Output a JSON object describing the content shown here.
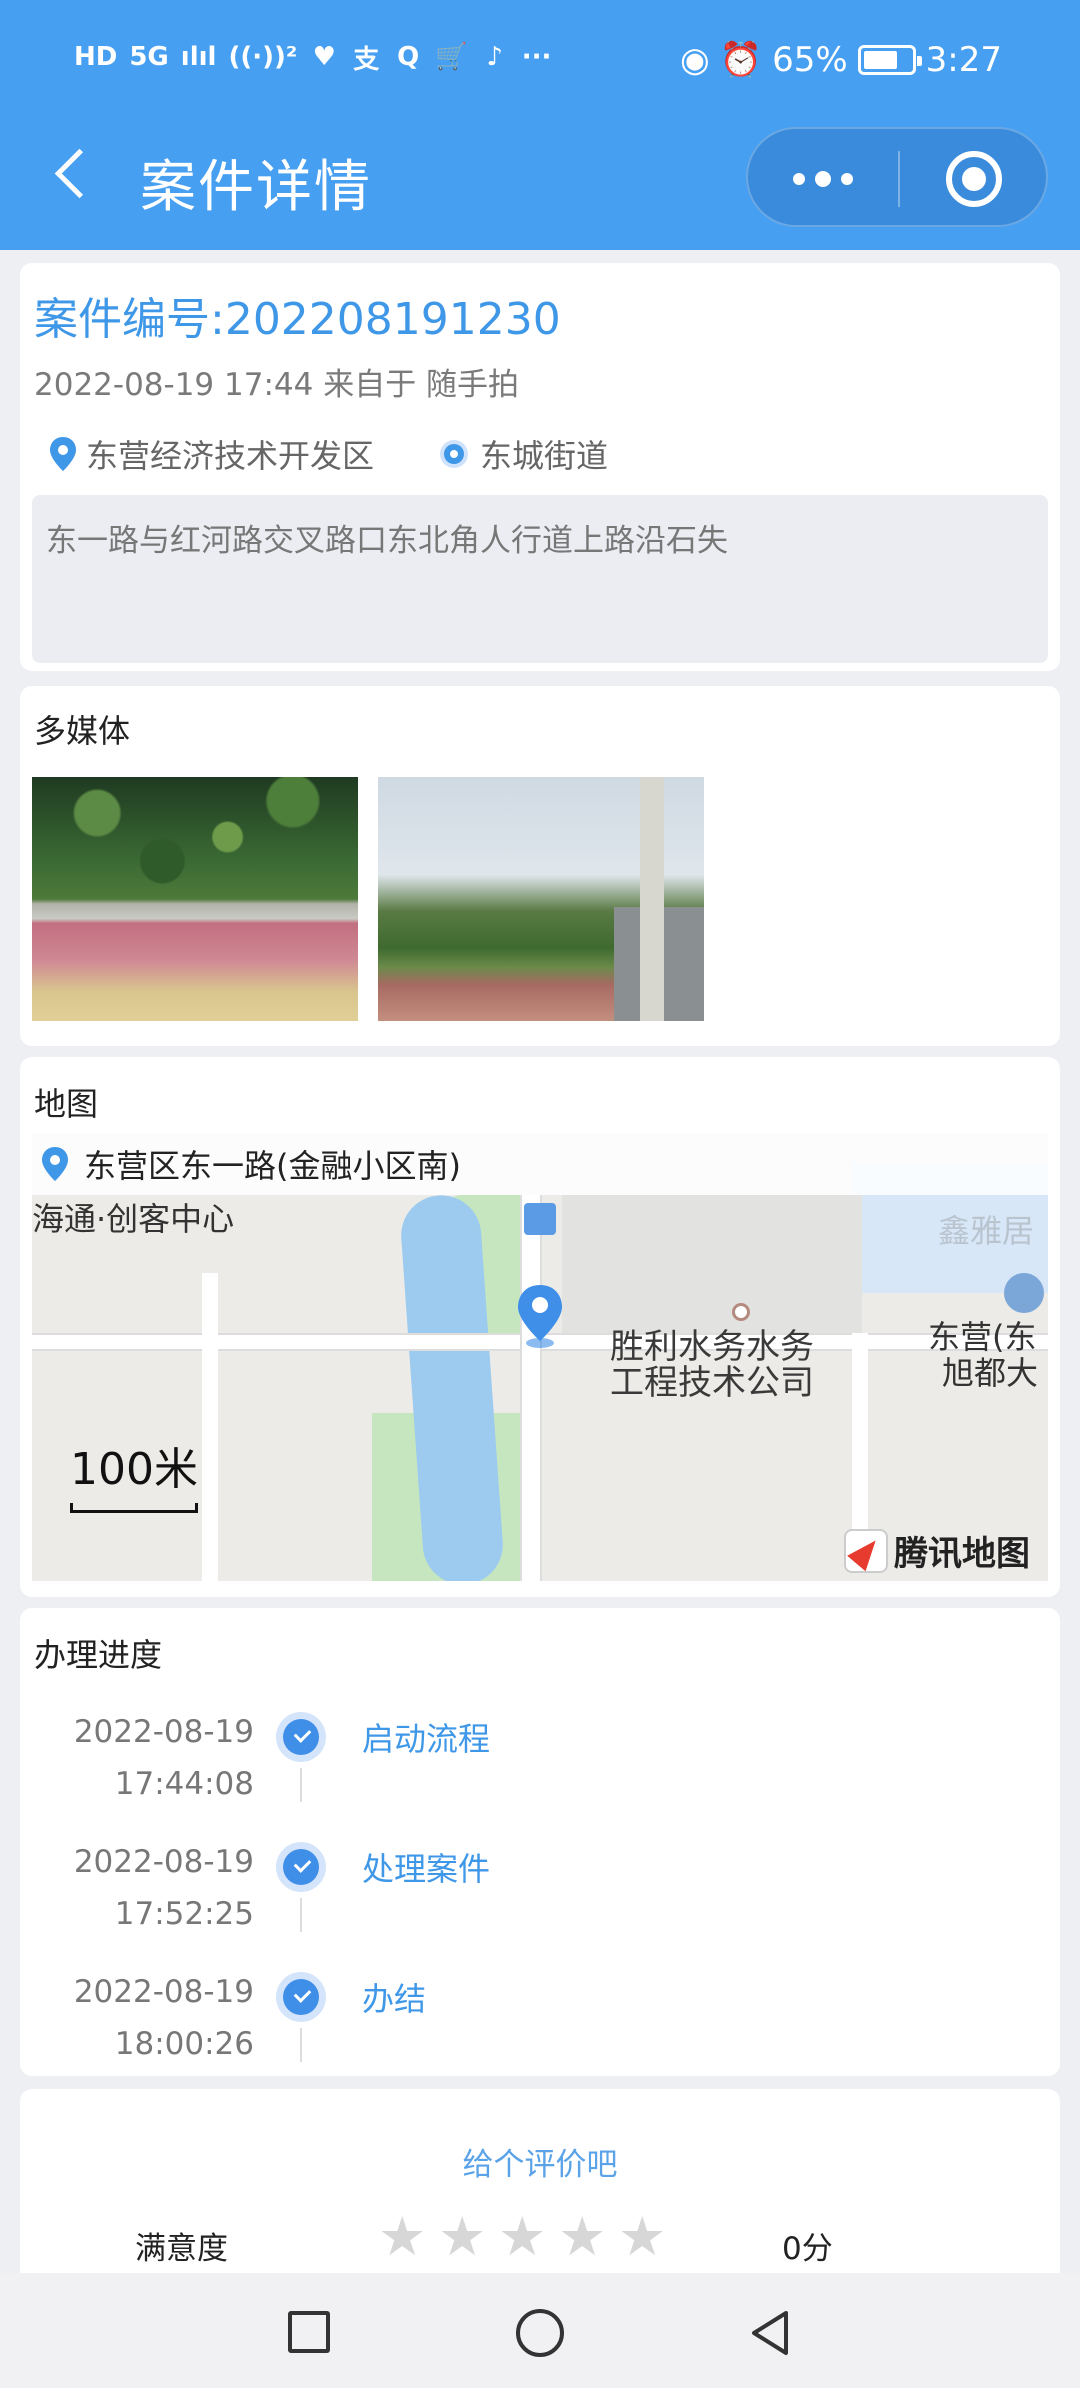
{
  "status_bar": {
    "left_items": [
      "HD",
      "5G",
      "ılıl",
      "((·))²",
      "♥",
      "支",
      "Q",
      "🛒",
      "♪",
      "···"
    ],
    "battery": "65%",
    "time": "3:27"
  },
  "navbar": {
    "title": "案件详情"
  },
  "case": {
    "id": "案件编号:202208191230",
    "meta": "2022-08-19 17:44 来自于 随手拍",
    "district": "东营经济技术开发区",
    "street": "东城街道",
    "description": "东一路与红河路交叉路口东北角人行道上路沿石失"
  },
  "media": {
    "title": "多媒体"
  },
  "map": {
    "title": "地图",
    "address": "东营区东一路(金融小区南)",
    "labels": {
      "creative_center": "海通·创客中心",
      "company_line1": "胜利水务水务",
      "company_line2": "工程技术公司",
      "right_line1": "东营(东",
      "right_line2": "旭都大",
      "top_right": "鑫雅居"
    },
    "scale": "100米",
    "provider": "腾讯地图"
  },
  "progress": {
    "title": "办理进度",
    "steps": [
      {
        "date": "2022-08-19",
        "time": "17:44:08",
        "label": "启动流程"
      },
      {
        "date": "2022-08-19",
        "time": "17:52:25",
        "label": "处理案件"
      },
      {
        "date": "2022-08-19",
        "time": "18:00:26",
        "label": "办结"
      }
    ]
  },
  "rating": {
    "prompt": "给个评价吧",
    "label": "满意度",
    "stars_total": 5,
    "stars_filled": 0,
    "score": "0分"
  },
  "colors": {
    "header": "#479ff2",
    "accent": "#3f97e8"
  }
}
